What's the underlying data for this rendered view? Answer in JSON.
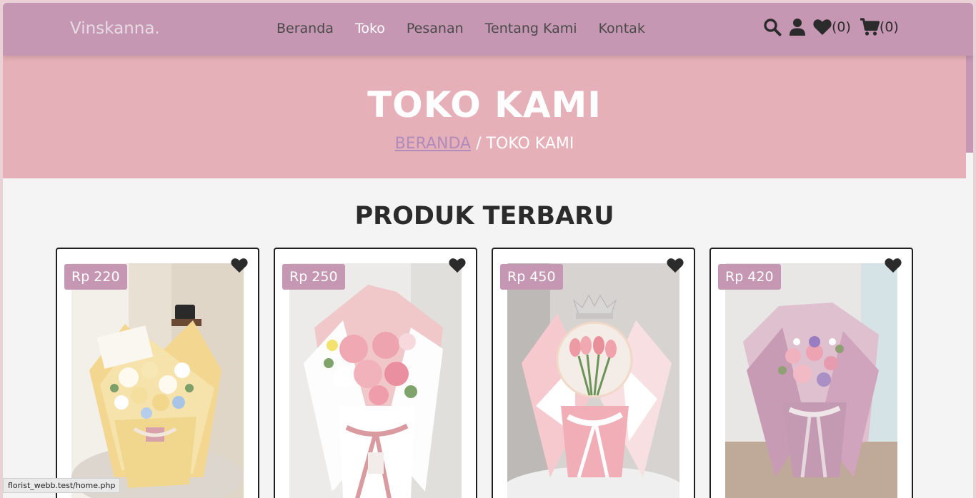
{
  "brand": {
    "name": "Vinskanna."
  },
  "nav": {
    "items": [
      {
        "label": "Beranda",
        "active": false
      },
      {
        "label": "Toko",
        "active": true
      },
      {
        "label": "Pesanan",
        "active": false
      },
      {
        "label": "Tentang Kami",
        "active": false
      },
      {
        "label": "Kontak",
        "active": false
      }
    ]
  },
  "header_icons": {
    "search": "search-icon",
    "user": "user-icon",
    "wishlist": {
      "icon": "heart-icon",
      "count": "(0)"
    },
    "cart": {
      "icon": "cart-icon",
      "count": "(0)"
    }
  },
  "hero": {
    "title": "TOKO KAMI",
    "breadcrumb_link": "BERANDA",
    "breadcrumb_sep": " / ",
    "breadcrumb_current": "TOKO KAMI"
  },
  "section": {
    "title": "PRODUK TERBARU"
  },
  "products": [
    {
      "price": "Rp 220",
      "image": "yellow-white-bouquet"
    },
    {
      "price": "Rp 250",
      "image": "pink-carnation-bouquet"
    },
    {
      "price": "Rp 450",
      "image": "tulip-balloon-bouquet"
    },
    {
      "price": "Rp 420",
      "image": "lilac-rose-bouquet"
    }
  ],
  "status_bar": {
    "url": "florist_webb.test/home.php"
  },
  "colors": {
    "header": "#c597b3",
    "hero": "#e6b0b8",
    "accent": "#c597b3",
    "background": "#f4f4f4"
  }
}
